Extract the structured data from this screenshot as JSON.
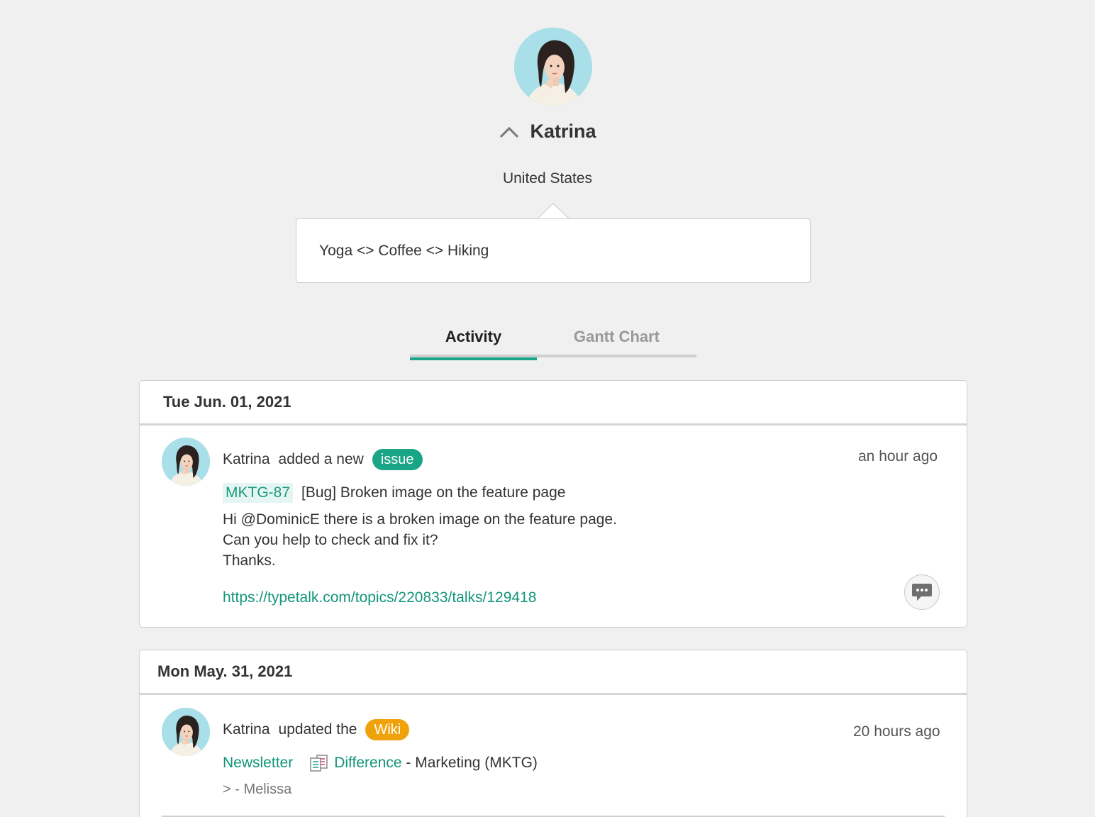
{
  "profile": {
    "name": "Katrina",
    "location": "United States",
    "bio": "Yoga <> Coffee <> Hiking",
    "icons": {
      "collapse": "chevron-up-icon",
      "avatar": "avatar"
    }
  },
  "tabs": [
    {
      "label": "Activity",
      "active": true
    },
    {
      "label": "Gantt Chart",
      "active": false
    }
  ],
  "activity": [
    {
      "date": "Tue Jun. 01, 2021",
      "actor": "Katrina",
      "action": "added a new",
      "badge": "issue",
      "time": "an hour ago",
      "issue_key": "MKTG-87",
      "issue_title": "[Bug] Broken image on the feature page",
      "body_lines": [
        "Hi @DominicE there is a broken image on the feature page.",
        "Can you help to check and fix it?",
        "Thanks."
      ],
      "link": "https://typetalk.com/topics/220833/talks/129418",
      "comment_icon": "comment-icon"
    },
    {
      "date": "Mon May. 31, 2021",
      "actor": "Katrina",
      "action": "updated the",
      "badge": "Wiki",
      "time": "20 hours ago",
      "wiki_page": "Newsletter",
      "diff_label": "Difference",
      "project_sep": " - ",
      "project": "Marketing (MKTG)",
      "quote": "> - Melissa",
      "diff_icon": "diff-icon"
    }
  ],
  "colors": {
    "accent": "#1aa587",
    "link": "#12957b",
    "wiki_badge": "#f0a20a",
    "background": "#f0f0f0"
  }
}
